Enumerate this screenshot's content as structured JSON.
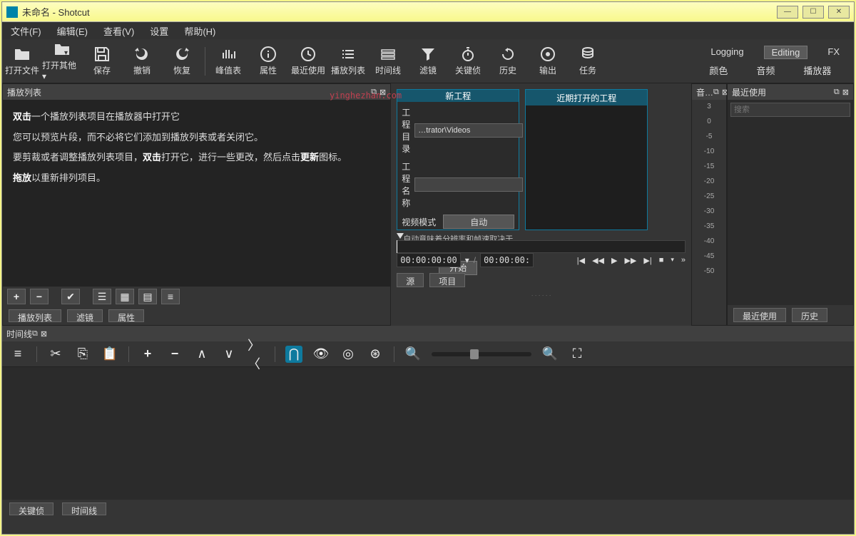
{
  "title": "未命名 - Shotcut",
  "menu": [
    "文件(F)",
    "编辑(E)",
    "查看(V)",
    "设置",
    "帮助(H)"
  ],
  "toolbar": [
    {
      "label": "打开文件",
      "icon": "folder"
    },
    {
      "label": "打开其他",
      "icon": "folder-plus",
      "drop": true
    },
    {
      "label": "保存",
      "icon": "save"
    },
    {
      "label": "撤销",
      "icon": "undo"
    },
    {
      "label": "恢复",
      "icon": "redo"
    },
    {
      "sep": true
    },
    {
      "label": "峰值表",
      "icon": "meter"
    },
    {
      "label": "属性",
      "icon": "info"
    },
    {
      "label": "最近使用",
      "icon": "clock"
    },
    {
      "label": "播放列表",
      "icon": "list"
    },
    {
      "label": "时间线",
      "icon": "timeline"
    },
    {
      "label": "滤镜",
      "icon": "filter"
    },
    {
      "label": "关键侦",
      "icon": "stopwatch"
    },
    {
      "label": "历史",
      "icon": "history"
    },
    {
      "label": "输出",
      "icon": "disc"
    },
    {
      "label": "任务",
      "icon": "stack"
    }
  ],
  "modes_top": [
    {
      "label": "Logging",
      "active": false
    },
    {
      "label": "Editing",
      "active": true
    },
    {
      "label": "FX",
      "active": false
    }
  ],
  "modes_bottom": [
    "颜色",
    "音频",
    "播放器"
  ],
  "playlist": {
    "title": "播放列表",
    "lines": [
      {
        "pre": "双击",
        "text": "一个播放列表项目在播放器中打开它"
      },
      {
        "text": "您可以预览片段，而不必将它们添加到播放列表或者关闭它。"
      },
      {
        "pre": "",
        "mid": "要剪裁或者调整播放列表项目，",
        "b": "双击",
        "text2": "打开它，进行一些更改，然后点击",
        "b2": "更新",
        "text3": "图标。"
      },
      {
        "pre": "拖放",
        "text": "以重新排列项目。"
      }
    ],
    "tabs": [
      "播放列表",
      "滤镜",
      "属性"
    ]
  },
  "watermark": "yinghezhan.com",
  "project": {
    "new_title": "新工程",
    "recent_title": "近期打开的工程",
    "dir_label": "工程目录",
    "dir_value": "…trator\\Videos",
    "name_label": "工程名称",
    "mode_label": "视频模式",
    "mode_value": "自动",
    "note": "自动意味着分辨率和帧速取决于 首个 文件您",
    "start": "开始"
  },
  "transport": {
    "tc1": "00:00:00:00",
    "tc2": "00:00:00:",
    "tabs": [
      "源",
      "项目"
    ]
  },
  "meter": {
    "title": "音…",
    "scale": [
      "3",
      "0",
      "-5",
      "-10",
      "-15",
      "-20",
      "-25",
      "-30",
      "-35",
      "-40",
      "-45",
      "-50"
    ]
  },
  "recent": {
    "title": "最近使用",
    "search_ph": "搜索",
    "tabs": [
      "最近使用",
      "历史"
    ]
  },
  "timeline": {
    "title": "时间线",
    "tabs": [
      "关键侦",
      "时间线"
    ]
  }
}
